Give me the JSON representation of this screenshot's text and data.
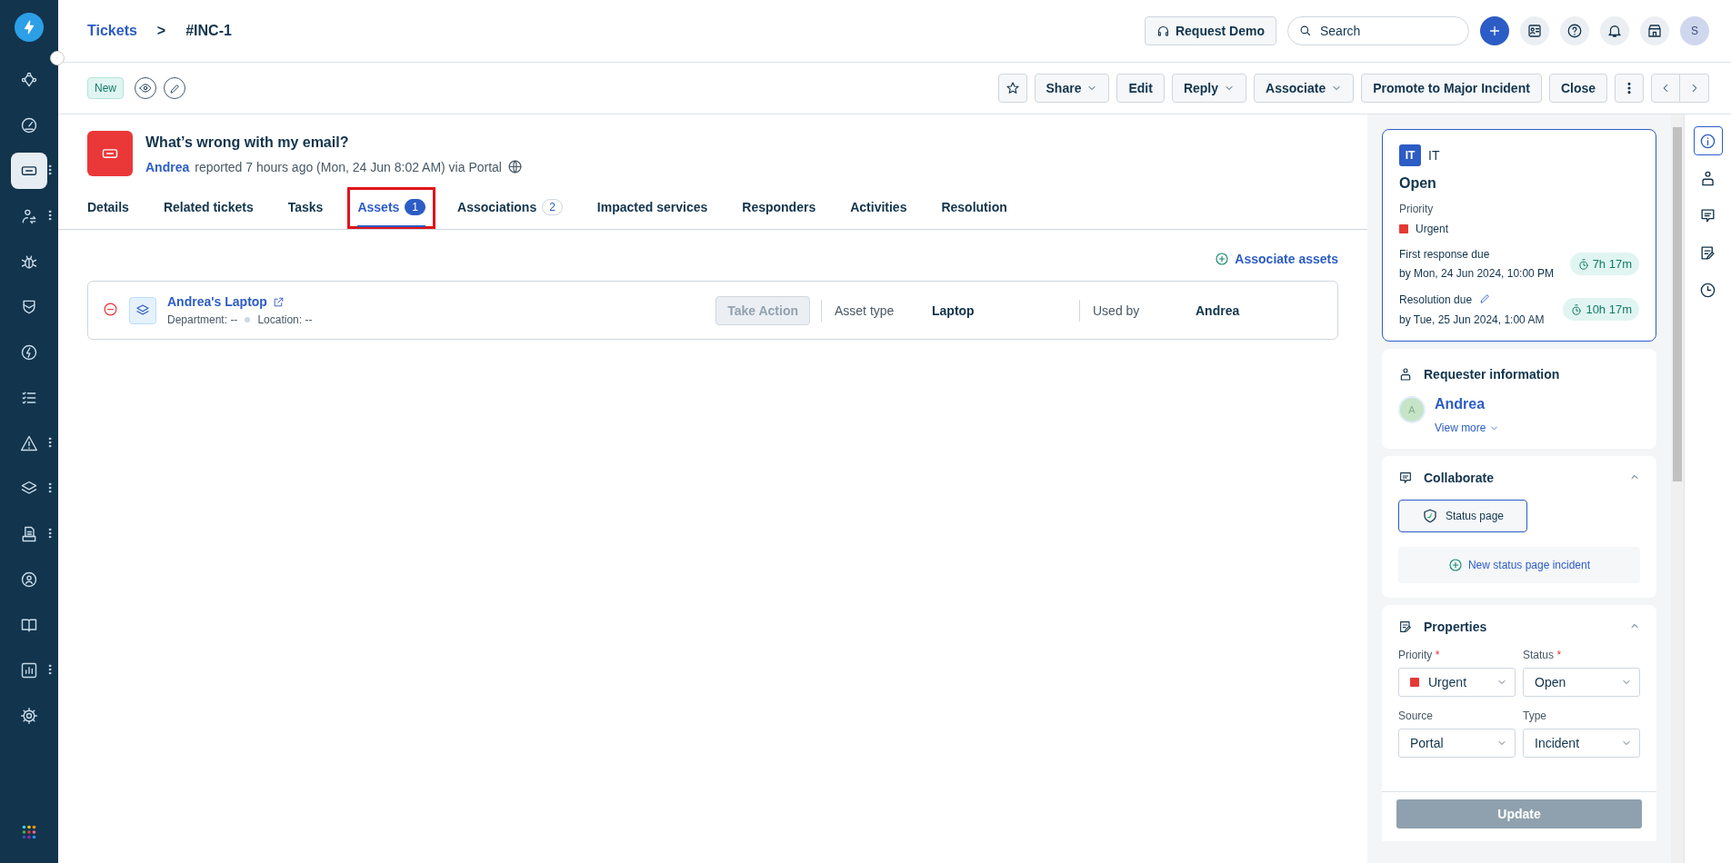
{
  "sidebar": {
    "items": [
      {
        "selected": false,
        "menu": false
      },
      {
        "selected": false,
        "menu": false
      },
      {
        "selected": true,
        "menu": true
      },
      {
        "selected": false,
        "menu": true
      },
      {
        "selected": false,
        "menu": false
      },
      {
        "selected": false,
        "menu": false
      },
      {
        "selected": false,
        "menu": false
      },
      {
        "selected": false,
        "menu": false
      },
      {
        "selected": false,
        "menu": true
      },
      {
        "selected": false,
        "menu": true
      },
      {
        "selected": false,
        "menu": true
      },
      {
        "selected": false,
        "menu": false
      },
      {
        "selected": false,
        "menu": false
      },
      {
        "selected": false,
        "menu": true
      },
      {
        "selected": false,
        "menu": false
      }
    ]
  },
  "breadcrumb": {
    "parent": "Tickets",
    "separator": ">",
    "current": "#INC-1"
  },
  "header_actions": {
    "demo_button": "Request Demo",
    "search": {
      "placeholder": "Search"
    },
    "avatar": "S"
  },
  "toolbar": {
    "status_tag": "New",
    "buttons": [
      {
        "label": "Share",
        "dropdown": true
      },
      {
        "label": "Edit",
        "dropdown": false
      },
      {
        "label": "Reply",
        "dropdown": true
      },
      {
        "label": "Associate",
        "dropdown": true
      },
      {
        "label": "Promote to Major Incident",
        "dropdown": false
      },
      {
        "label": "Close",
        "dropdown": false
      }
    ]
  },
  "ticket": {
    "subject": "What’s wrong with my email?",
    "requester": "Andrea",
    "meta": "reported 7 hours ago (Mon, 24 Jun 8:02 AM) via Portal"
  },
  "tabs": [
    {
      "label": "Details",
      "selected": false
    },
    {
      "label": "Related tickets",
      "selected": false
    },
    {
      "label": "Tasks",
      "selected": false
    },
    {
      "label": "Assets",
      "count": "1",
      "selected": true,
      "highlighted": true
    },
    {
      "label": "Associations",
      "count": "2",
      "selected": false
    },
    {
      "label": "Impacted services",
      "selected": false
    },
    {
      "label": "Responders",
      "selected": false
    },
    {
      "label": "Activities",
      "selected": false
    },
    {
      "label": "Resolution",
      "selected": false
    }
  ],
  "associate_link": "Associate assets",
  "assets": [
    {
      "name": "Andrea's Laptop",
      "department_label": "Department:",
      "department": "--",
      "location_label": "Location:",
      "location": "--",
      "action": "Take Action",
      "type_label": "Asset type",
      "type": "Laptop",
      "used_by_label": "Used by",
      "used_by": "Andrea"
    }
  ],
  "summary": {
    "group_badge": "IT",
    "group": "IT",
    "status": "Open",
    "priority_label": "Priority",
    "priority": "Urgent",
    "slas": [
      {
        "label": "First response due",
        "due": "by Mon, 24 Jun 2024, 10:00 PM",
        "timer": "7h 17m",
        "editable": false
      },
      {
        "label": "Resolution due",
        "due": "by Tue, 25 Jun 2024, 1:00 AM",
        "timer": "10h 17m",
        "editable": true
      }
    ]
  },
  "requester": {
    "title": "Requester information",
    "avatar": "A",
    "name": "Andrea",
    "view_more": "View more"
  },
  "collaborate": {
    "title": "Collaborate",
    "expanded": true,
    "tool": "Status page",
    "action": "New status page incident"
  },
  "properties": {
    "title": "Properties",
    "expanded": true,
    "fields": [
      {
        "label": "Priority",
        "required_mark": "*",
        "value": "Urgent",
        "kind": "priority"
      },
      {
        "label": "Status",
        "required_mark": "*",
        "value": "Open",
        "kind": "plain"
      },
      {
        "label": "Source",
        "value": "Portal",
        "kind": "plain"
      },
      {
        "label": "Type",
        "value": "Incident",
        "kind": "plain"
      }
    ],
    "submit": {
      "label": "Update",
      "disabled": true
    }
  },
  "rail": [
    {
      "selected": true
    },
    {
      "selected": false
    },
    {
      "selected": false
    },
    {
      "selected": false
    },
    {
      "selected": false
    }
  ]
}
